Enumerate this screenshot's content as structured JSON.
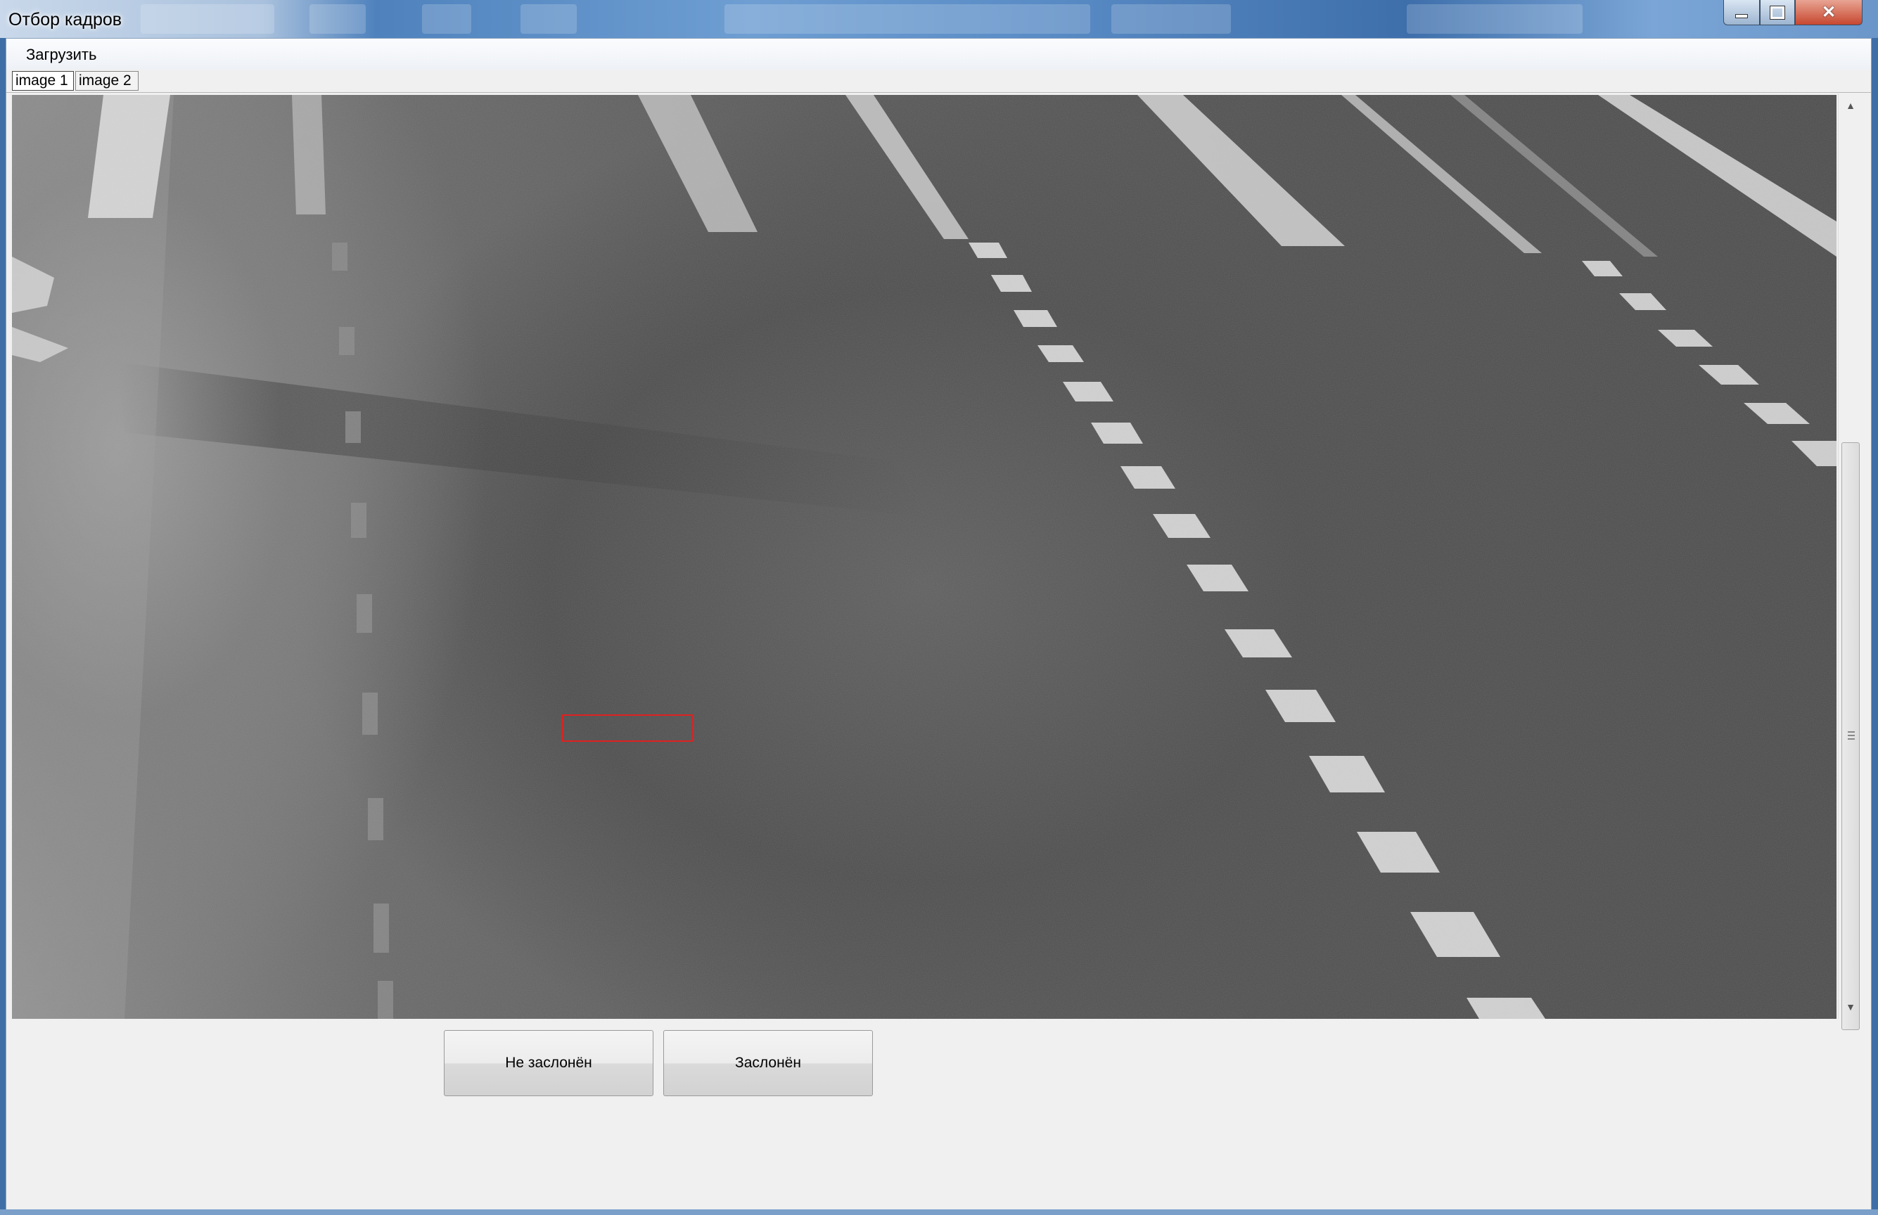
{
  "window": {
    "title": "Отбор кадров"
  },
  "menu": {
    "load_label": "Загрузить"
  },
  "tabs": [
    {
      "label": "image 1",
      "selected": true
    },
    {
      "label": "image 2",
      "selected": false
    }
  ],
  "actions": {
    "not_occluded_label": "Не заслонён",
    "occluded_label": "Заслонён"
  },
  "colors": {
    "selection_box": "#e02020",
    "title_glass": "#4f82bd",
    "close_button": "#c7472f"
  },
  "icons": {
    "minimize": "minimize-icon",
    "maximize": "maximize-icon",
    "close": "close-icon",
    "scroll_up": "scroll-up-arrow-icon",
    "scroll_down": "scroll-down-arrow-icon"
  }
}
